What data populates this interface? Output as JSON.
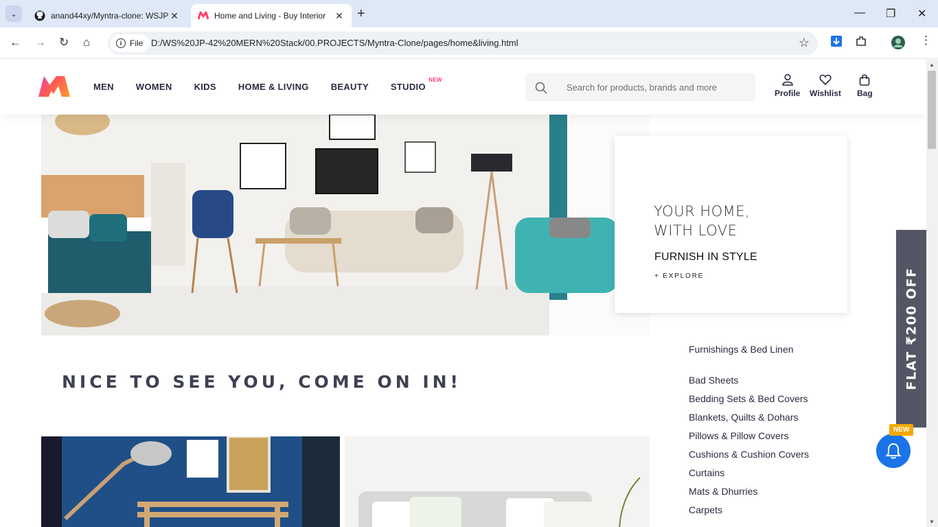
{
  "browser": {
    "tabs": [
      {
        "title": "anand44xy/Myntra-clone: WSJP",
        "active": false
      },
      {
        "title": "Home and Living - Buy Interior",
        "active": true
      }
    ],
    "address": {
      "scheme_label": "File",
      "url": "D:/WS%20JP-42%20MERN%20Stack/00.PROJECTS/Myntra-Clone/pages/home&living.html"
    }
  },
  "header": {
    "nav": [
      "MEN",
      "WOMEN",
      "KIDS",
      "HOME & LIVING",
      "BEAUTY",
      "STUDIO"
    ],
    "studio_badge": "NEW",
    "search_placeholder": "Search for products, brands and more",
    "actions": {
      "profile": "Profile",
      "wishlist": "Wishlist",
      "bag": "Bag"
    },
    "brand_color": "#ff3f6c"
  },
  "promo": {
    "headline_line1": "YOUR HOME,",
    "headline_line2": "WITH LOVE",
    "subhead": "FURNISH IN STYLE",
    "cta": "+ EXPLORE"
  },
  "welcome_text": "NICE TO SEE YOU, COME ON IN!",
  "categories": {
    "title": "Furnishings & Bed Linen",
    "items": [
      "Bad Sheets",
      "Bedding Sets & Bed Covers",
      "Blankets, Quilts & Dohars",
      "Pillows & Pillow Covers",
      "Cushions & Cushion Covers",
      "Curtains",
      "Mats & Dhurries",
      "Carpets"
    ]
  },
  "side_offer": "FLAT ₹200 OFF",
  "notification_badge": "NEW"
}
